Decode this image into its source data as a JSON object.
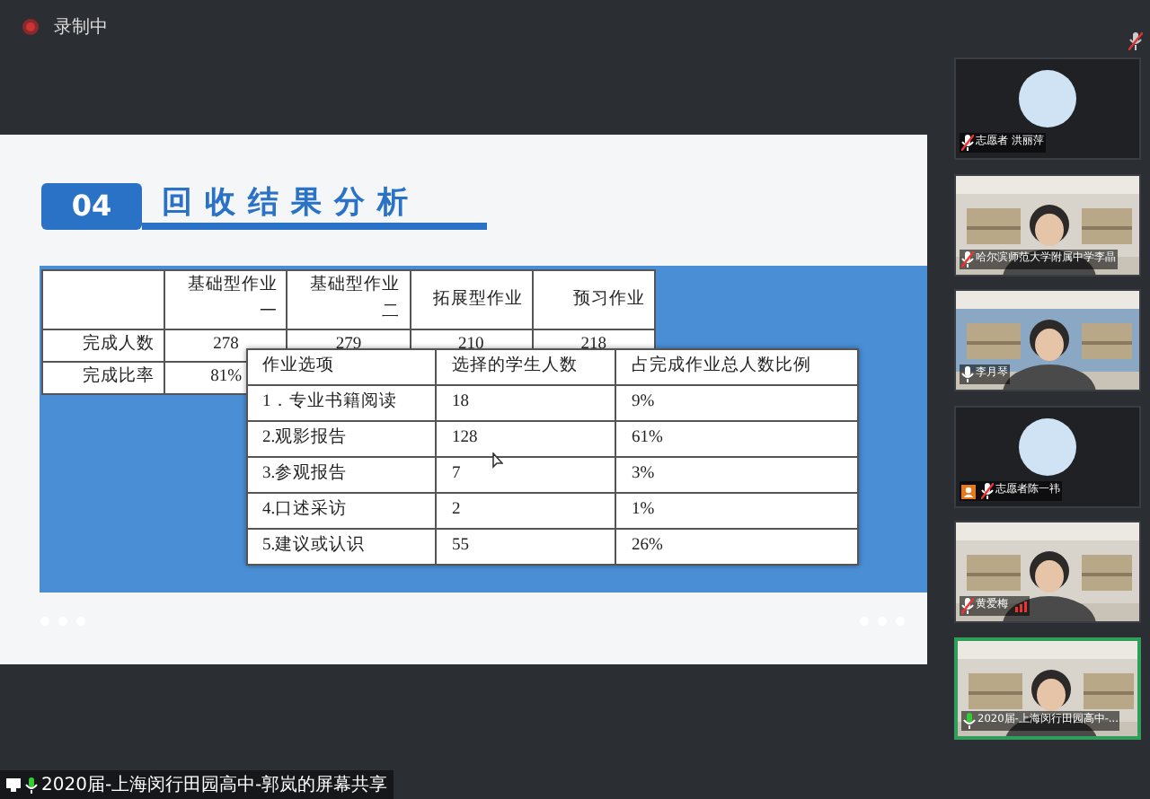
{
  "recording": {
    "label": "录制中",
    "on": true
  },
  "slide": {
    "number": "04",
    "title": "回收结果分析",
    "table_1": {
      "columns": [
        "",
        "基础型作业一",
        "基础型作业二",
        "拓展型作业",
        "预习作业"
      ],
      "rows": [
        [
          "完成人数",
          "278",
          "279",
          "210",
          "218"
        ],
        [
          "完成比率",
          "81%"
        ]
      ]
    },
    "table_2": {
      "columns": [
        "作业选项",
        "选择的学生人数",
        "占完成作业总人数比例"
      ],
      "rows": [
        [
          "1．专业书籍阅读",
          "18",
          "9%"
        ],
        [
          "2.观影报告",
          "128",
          "61%"
        ],
        [
          "3.参观报告",
          "7",
          "3%"
        ],
        [
          "4.口述采访",
          "2",
          "1%"
        ],
        [
          "5.建议或认识",
          "55",
          "26%"
        ]
      ]
    }
  },
  "participants": [
    {
      "name": "志愿者 洪丽萍",
      "kind": "avatar",
      "muted": true,
      "selected": false
    },
    {
      "name": "哈尔滨师范大学附属中学李晶",
      "kind": "video",
      "muted": true,
      "selected": false
    },
    {
      "name": "李月琴",
      "kind": "video",
      "muted": false,
      "selected": false
    },
    {
      "name": "志愿者陈一祎",
      "kind": "avatar",
      "muted": true,
      "selected": false,
      "host": true
    },
    {
      "name": "黄爱梅",
      "kind": "video",
      "muted": true,
      "selected": false,
      "signal": true
    },
    {
      "name": "2020届-上海闵行田园高中-...",
      "kind": "video",
      "muted": false,
      "selected": true
    }
  ],
  "share_label": "2020届-上海闵行田园高中-郭岚的屏幕共享"
}
